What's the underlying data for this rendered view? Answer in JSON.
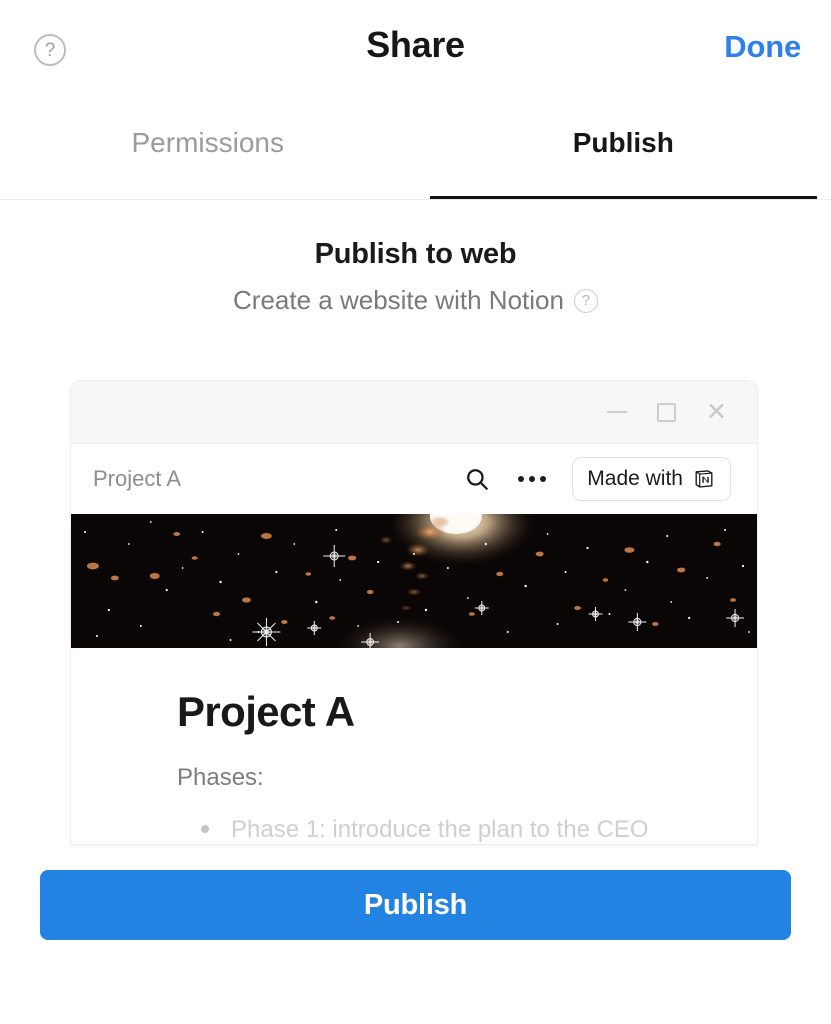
{
  "header": {
    "title": "Share",
    "help_icon": "question-circle-icon",
    "done_label": "Done"
  },
  "tabs": [
    {
      "label": "Permissions",
      "active": false
    },
    {
      "label": "Publish",
      "active": true
    }
  ],
  "section": {
    "title": "Publish to web",
    "subtitle": "Create a website with Notion",
    "subtitle_help_icon": "question-circle-icon"
  },
  "preview": {
    "window_controls": {
      "minimize": "minimize-icon",
      "maximize": "maximize-icon",
      "close": "close-icon"
    },
    "site_bar": {
      "title": "Project A",
      "search_icon": "search-icon",
      "more_icon": "more-horizontal-icon",
      "badge_label": "Made with",
      "badge_logo": "notion-logo-icon"
    },
    "cover_image": "deep-space-galaxy-photo",
    "page": {
      "title": "Project A",
      "paragraph": "Phases:",
      "bullets": [
        "Phase 1: introduce the plan to the CEO"
      ]
    }
  },
  "footer": {
    "publish_label": "Publish"
  },
  "colors": {
    "accent_blue": "#2383e2",
    "link_blue": "#2f80ed",
    "text_primary": "#171717",
    "text_muted": "#9b9b9b",
    "tab_underline": "#111111"
  }
}
